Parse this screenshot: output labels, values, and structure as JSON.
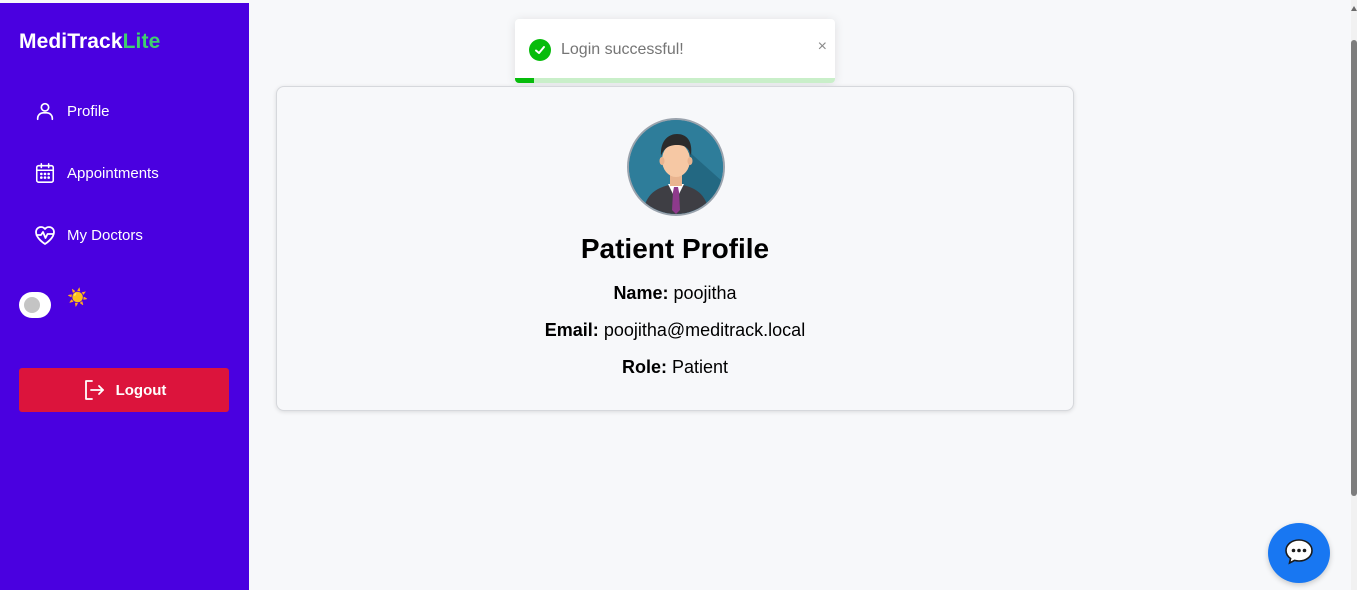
{
  "brand": {
    "primary": "MediTrack",
    "accent": "Lite",
    "accent_color": "#3fcf6e"
  },
  "sidebar": {
    "background": "#4a00e0",
    "items": [
      {
        "label": "Profile",
        "icon": "user-icon"
      },
      {
        "label": "Appointments",
        "icon": "calendar-icon"
      },
      {
        "label": "My Doctors",
        "icon": "heart-pulse-icon"
      }
    ],
    "theme_toggle": {
      "state": "off",
      "icon": "sun-icon",
      "icon_glyph": "☀️"
    },
    "logout": {
      "label": "Logout",
      "icon": "logout-icon",
      "color": "#dc143c"
    }
  },
  "toast": {
    "message": "Login successful!",
    "type": "success",
    "icon": "check-circle-icon",
    "close_glyph": "×",
    "progress_remaining": 0.06
  },
  "profile": {
    "title": "Patient Profile",
    "avatar": "avatar-man-icon",
    "fields": [
      {
        "label": "Name:",
        "value": "poojitha"
      },
      {
        "label": "Email:",
        "value": "poojitha@meditrack.local"
      },
      {
        "label": "Role:",
        "value": "Patient"
      }
    ]
  },
  "chat": {
    "icon": "chat-bubble-icon",
    "color": "#1877f2"
  }
}
